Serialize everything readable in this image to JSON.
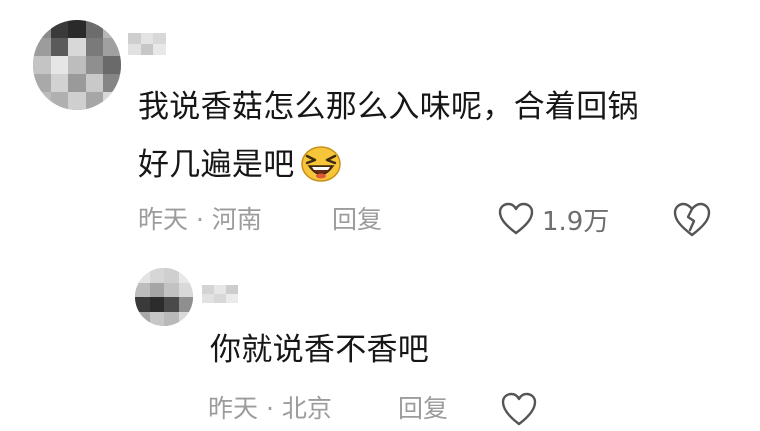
{
  "main_comment": {
    "username": "",
    "text_line1": "我说香菇怎么那么入味呢，合着回锅",
    "text_line2": "好几遍是吧",
    "emoji": "laughing-emoji",
    "time": "昨天",
    "separator": "·",
    "location": "河南",
    "reply_label": "回复",
    "like_count": "1.9万",
    "like_icon": "heart-outline-icon",
    "dislike_icon": "broken-heart-icon"
  },
  "reply_comment": {
    "username": "",
    "text": "你就说香不香吧",
    "time": "昨天",
    "separator": "·",
    "location": "北京",
    "reply_label": "回复",
    "like_icon": "heart-outline-icon"
  },
  "colors": {
    "text_primary": "#161616",
    "text_meta": "#9c9c9c",
    "icon_stroke": "#555555",
    "emoji_yellow": "#f7c53a"
  }
}
